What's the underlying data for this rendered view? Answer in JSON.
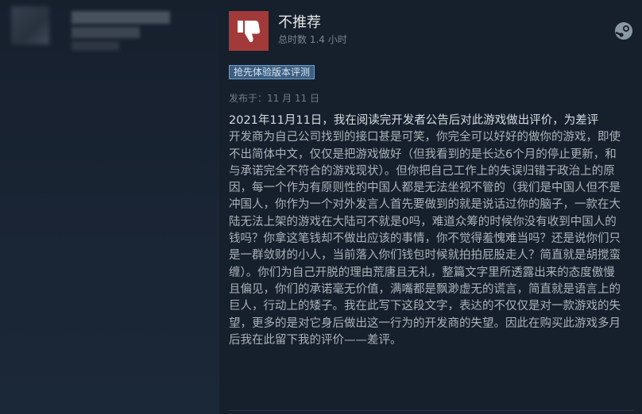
{
  "reviewer": {
    "avatar": "blurred-avatar",
    "name": "",
    "details": ""
  },
  "review": {
    "verdict": "不推荐",
    "verdict_icon": "thumbs-down-icon",
    "verdict_color": "#a33a3a",
    "hours": "总时数 1.4 小时",
    "platform_icon": "steam-icon",
    "badge": "抢先体验版本评测",
    "posted": "发布于：11 月 11 日",
    "first_line": "2021年11月11日，我在阅读完开发者公告后对此游戏做出评价，为差评",
    "body": "开发商为自己公司找到的接口甚是可笑，你完全可以好好的做你的游戏，即使不出简体中文，仅仅是把游戏做好（但我看到的是长达6个月的停止更新，和与承诺完全不符合的游戏现状）。但你把自己工作上的失误归错于政治上的原因，每一个作为有原则性的中国人都是无法坐视不管的（我们是中国人但不是冲国人，你作为一个对外发言人首先要做到的就是说话过你的脑子，一款在大陆无法上架的游戏在大陆可不就是0吗，难道众筹的时候你没有收到中国人的钱吗？你拿这笔钱却不做出应该的事情，你不觉得羞愧难当吗？还是说你们只是一群敛财的小人，当前落入你们钱包时候就拍拍屁股走人？简直就是胡搅蛮缠）。你们为自己开脱的理由荒唐且无礼，整篇文字里所透露出来的态度傲慢且偏见，你们的承诺毫无价值，满嘴都是飘渺虚无的谎言，简直就是语言上的巨人，行动上的矮子。我在此写下这段文字，表达的不仅仅是对一款游戏的失望，更多的是对它身后做出这一行为的开发商的失望。因此在购买此游戏多月后我在此留下我的评价——差评。"
  }
}
